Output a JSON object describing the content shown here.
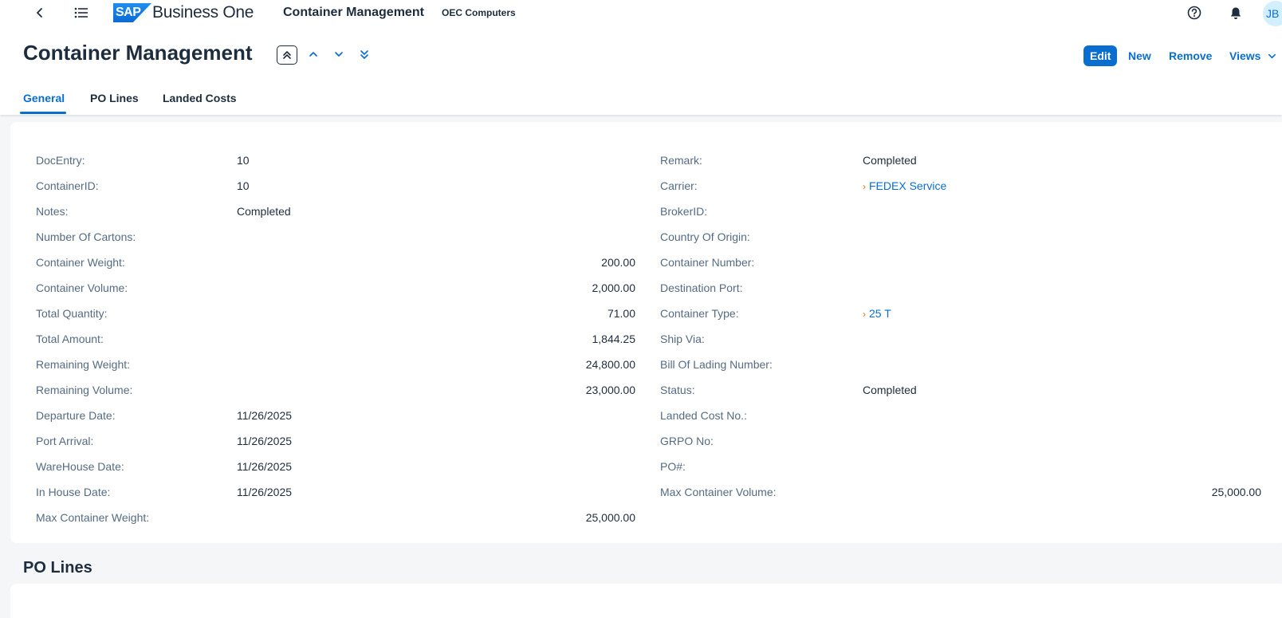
{
  "shell": {
    "brand": "SAP",
    "product": "Business One",
    "title": "Container Management",
    "company": "OEC Computers",
    "user_initials": "JB"
  },
  "header": {
    "title": "Container Management",
    "actions": {
      "edit": "Edit",
      "new": "New",
      "remove": "Remove",
      "views": "Views"
    },
    "tabs": [
      "General",
      "PO Lines",
      "Landed Costs"
    ],
    "selected_tab": "General"
  },
  "form": {
    "left": [
      {
        "label": "DocEntry:",
        "value": "10"
      },
      {
        "label": "ContainerID:",
        "value": "10"
      },
      {
        "label": "Notes:",
        "value": "Completed"
      },
      {
        "label": "Number Of Cartons:",
        "value": ""
      },
      {
        "label": "Container Weight:",
        "value": "200.00"
      },
      {
        "label": "Container Volume:",
        "value": "2,000.00"
      },
      {
        "label": "Total Quantity:",
        "value": "71.00"
      },
      {
        "label": "Total Amount:",
        "value": "1,844.25"
      },
      {
        "label": "Remaining Weight:",
        "value": "24,800.00"
      },
      {
        "label": "Remaining Volume:",
        "value": "23,000.00"
      },
      {
        "label": "Departure Date:",
        "value": "11/26/2025"
      },
      {
        "label": "Port Arrival:",
        "value": "11/26/2025"
      },
      {
        "label": "WareHouse Date:",
        "value": "11/26/2025"
      },
      {
        "label": "In House Date:",
        "value": "11/26/2025"
      },
      {
        "label": "Max Container Weight:",
        "value": "25,000.00"
      }
    ],
    "right": [
      {
        "label": "Remark:",
        "value": "Completed"
      },
      {
        "label": "Carrier:",
        "value": "FEDEX Service"
      },
      {
        "label": "BrokerID:",
        "value": ""
      },
      {
        "label": "Country Of Origin:",
        "value": ""
      },
      {
        "label": "Container Number:",
        "value": ""
      },
      {
        "label": "Destination Port:",
        "value": ""
      },
      {
        "label": "Container Type:",
        "value": "25 T"
      },
      {
        "label": "Ship Via:",
        "value": ""
      },
      {
        "label": "Bill Of Lading Number:",
        "value": ""
      },
      {
        "label": "Status:",
        "value": "Completed"
      },
      {
        "label": "Landed Cost No.:",
        "value": ""
      },
      {
        "label": "GRPO No:",
        "value": ""
      },
      {
        "label": "PO#:",
        "value": ""
      },
      {
        "label": "Max Container Volume:",
        "value": "25,000.00"
      }
    ]
  },
  "sections": {
    "po_lines": "PO Lines"
  },
  "colors": {
    "accent": "#0a6ed1",
    "link_chevron": "#e9730c",
    "label": "#556b82",
    "text": "#1d2d3e"
  },
  "icons": [
    "back-icon",
    "menu-list-icon",
    "help-icon",
    "bell-icon",
    "collapse-header-icon",
    "chevron-up-icon",
    "chevron-down-icon",
    "double-chevron-down-icon",
    "chevron-right-icon"
  ]
}
